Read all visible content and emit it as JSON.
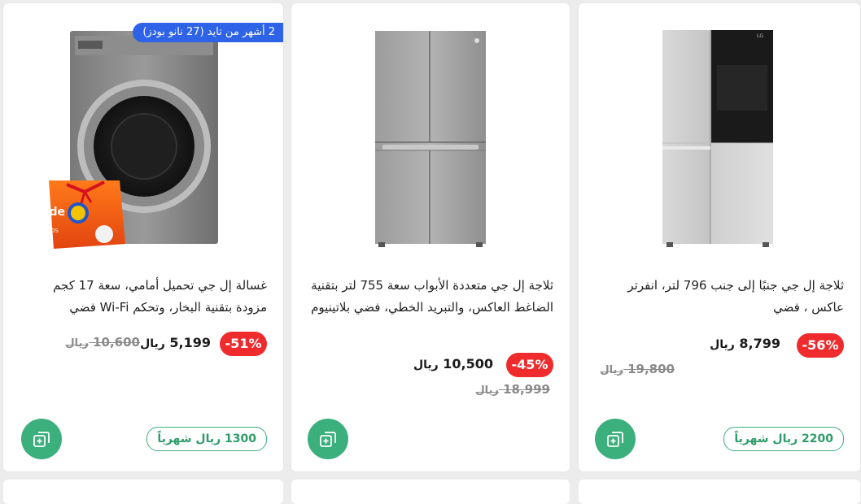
{
  "products": [
    {
      "title": "ثلاجة إل جي جنبًا إلى جنب 796 لتر، انفرتر عاكس ، فضي",
      "discount": "-56%",
      "price": "8,799",
      "old_price": "19,800",
      "currency": "ريال",
      "monthly": "2200 ريال شهرياً",
      "image": "side-by-side-fridge"
    },
    {
      "title": "ثلاجة إل جي متعددة الأبواب سعة 755 لتر بتقنية الضاغط العاكس، والتبريد الخطي، فضي بلاتينيوم",
      "discount": "-45%",
      "price": "10,500",
      "old_price": "18,999",
      "currency": "ريال",
      "image": "french-door-fridge"
    },
    {
      "title": "غسالة إل جي تحميل أمامي، سعة 17 كجم مزودة بتقنية البخار، وتحكم Wi-Fi فضي",
      "discount": "-51%",
      "price": "5,199",
      "old_price": "10,600",
      "currency": "ريال",
      "monthly": "1300 ريال شهرياً",
      "promo": "2 أشهر من تايد (27 نانو بودز)",
      "image": "front-load-washer-with-tide",
      "tide_label": "Tide",
      "tide_sub": "NANO PODS"
    }
  ],
  "colors": {
    "accent_green": "#3cb07c",
    "discount_red": "#ef2b2d",
    "promo_blue": "#2e63e8"
  },
  "icons": {
    "cart": "add-to-cart-icon"
  }
}
